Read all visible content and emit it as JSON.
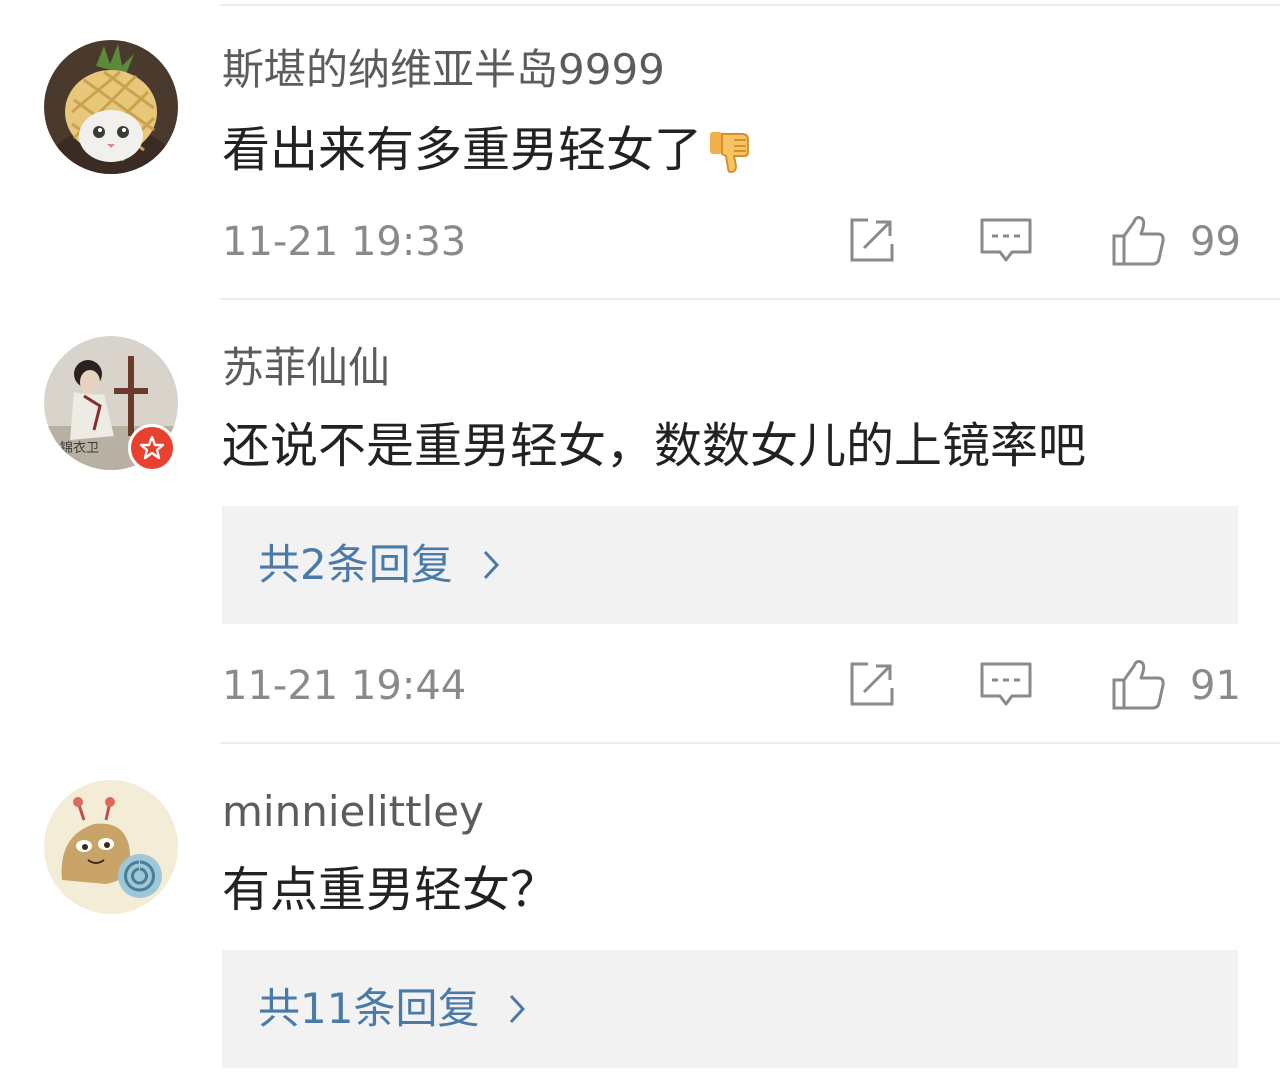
{
  "comments": [
    {
      "username": "斯堪的纳维亚半岛9999",
      "text": "看出来有多重男轻女了",
      "emoji": "thumbs-down-emoji",
      "timestamp": "11-21 19:33",
      "likes": "99",
      "replies": null
    },
    {
      "username": "苏菲仙仙",
      "text": "还说不是重男轻女，数数女儿的上镜率吧",
      "timestamp": "11-21 19:44",
      "likes": "91",
      "replies": "共2条回复",
      "verified_badge": true
    },
    {
      "username": "minnielittley",
      "text": "有点重男轻女？",
      "replies": "共11条回复"
    }
  ],
  "icons": {
    "share": "share-icon",
    "comment": "comment-icon",
    "like": "like-icon",
    "chevron": "chevron-right-icon"
  },
  "colors": {
    "link": "#4a7ba8",
    "badge": "#e8412f",
    "meta": "#8a8a8a"
  }
}
